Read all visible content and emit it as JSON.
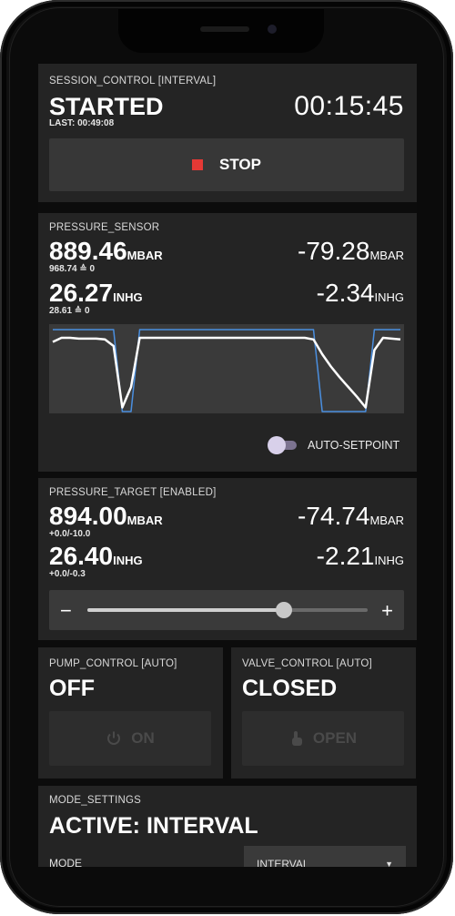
{
  "session": {
    "header": "SESSION_CONTROL [INTERVAL]",
    "state": "STARTED",
    "last": "LAST: 00:49:08",
    "timer": "00:15:45",
    "stop_label": "STOP"
  },
  "sensor": {
    "header": "PRESSURE_SENSOR",
    "abs_mbar": "889.46",
    "abs_mbar_unit": "MBAR",
    "abs_mbar_sub": "968.74 ≙ 0",
    "rel_mbar": "-79.28",
    "rel_mbar_unit": "MBAR",
    "abs_inhg": "26.27",
    "abs_inhg_unit": "INHG",
    "abs_inhg_sub": "28.61 ≙ 0",
    "rel_inhg": "-2.34",
    "rel_inhg_unit": "INHG",
    "auto_setpoint_label": "AUTO-SETPOINT",
    "auto_setpoint_on": false
  },
  "chart_data": {
    "type": "line",
    "title": "",
    "xlabel": "",
    "ylabel": "",
    "grid": false,
    "ylim": [
      0,
      1
    ],
    "x": [
      0,
      1,
      2,
      3,
      4,
      5,
      6,
      7,
      8,
      9,
      10,
      11,
      12,
      13,
      14,
      15,
      16,
      17,
      18,
      19,
      20,
      21,
      22,
      23,
      24,
      25,
      26,
      27,
      28,
      29,
      30,
      31,
      32,
      33,
      34,
      35,
      36,
      37,
      38,
      39,
      40
    ],
    "series": [
      {
        "color": "#4a8fe0",
        "values": [
          1.0,
          1.0,
          1.0,
          1.0,
          1.0,
          1.0,
          1.0,
          1.0,
          0.0,
          0.0,
          1.0,
          1.0,
          1.0,
          1.0,
          1.0,
          1.0,
          1.0,
          1.0,
          1.0,
          1.0,
          1.0,
          1.0,
          1.0,
          1.0,
          1.0,
          1.0,
          1.0,
          1.0,
          1.0,
          1.0,
          1.0,
          0.0,
          0.0,
          0.0,
          0.0,
          0.0,
          0.0,
          1.0,
          1.0,
          1.0,
          1.0
        ]
      },
      {
        "color": "#ffffff",
        "values": [
          0.85,
          0.9,
          0.9,
          0.89,
          0.89,
          0.89,
          0.88,
          0.8,
          0.05,
          0.3,
          0.9,
          0.9,
          0.9,
          0.9,
          0.9,
          0.9,
          0.9,
          0.9,
          0.9,
          0.9,
          0.9,
          0.9,
          0.9,
          0.9,
          0.9,
          0.9,
          0.9,
          0.9,
          0.9,
          0.9,
          0.88,
          0.7,
          0.55,
          0.42,
          0.3,
          0.18,
          0.05,
          0.75,
          0.9,
          0.89,
          0.88
        ]
      }
    ]
  },
  "target": {
    "header": "PRESSURE_TARGET [ENABLED]",
    "abs_mbar": "894.00",
    "abs_mbar_unit": "MBAR",
    "abs_mbar_sub": "+0.0/-10.0",
    "rel_mbar": "-74.74",
    "rel_mbar_unit": "MBAR",
    "abs_inhg": "26.40",
    "abs_inhg_unit": "INHG",
    "abs_inhg_sub": "+0.0/-0.3",
    "rel_inhg": "-2.21",
    "rel_inhg_unit": "INHG",
    "slider_minus": "−",
    "slider_plus": "+",
    "slider_fraction": 0.7
  },
  "pump": {
    "header": "PUMP_CONTROL [AUTO]",
    "state": "OFF",
    "button_label": "ON",
    "button_icon": "power-icon"
  },
  "valve": {
    "header": "VALVE_CONTROL [AUTO]",
    "state": "CLOSED",
    "button_label": "OPEN",
    "button_icon": "touch-icon"
  },
  "mode": {
    "header": "MODE_SETTINGS",
    "active": "ACTIVE: INTERVAL",
    "mode_label": "MODE",
    "mode_value": "INTERVAL"
  }
}
